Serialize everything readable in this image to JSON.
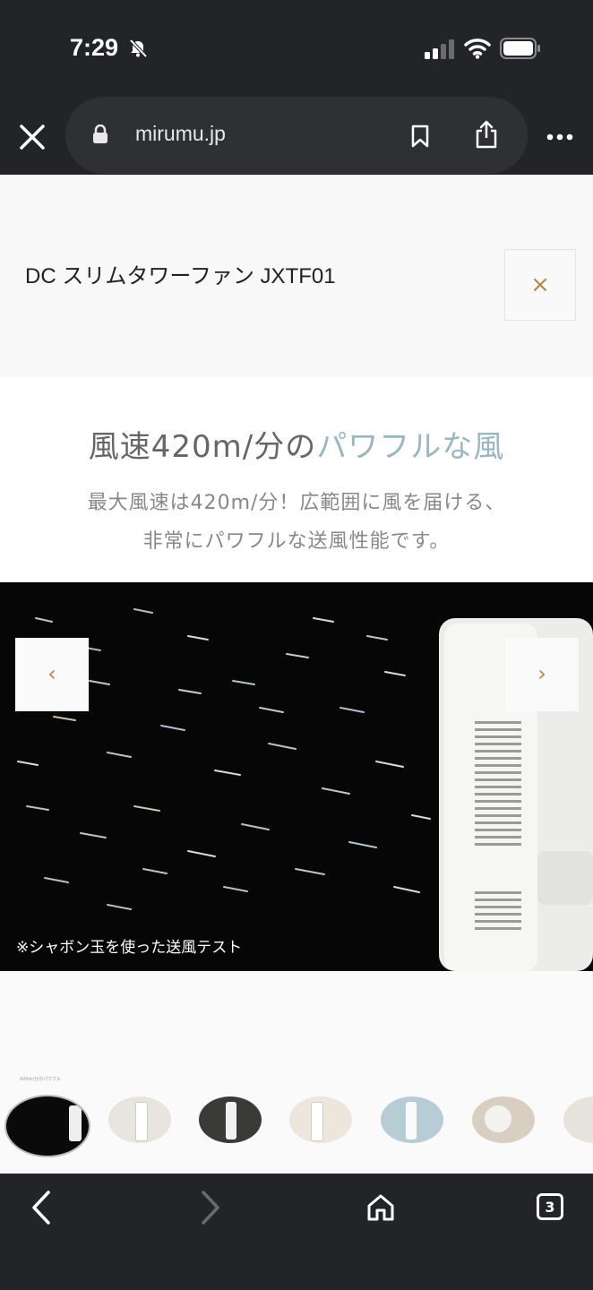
{
  "status_bar": {
    "time": "7:29"
  },
  "browser": {
    "url": "mirumu.jp",
    "tab_count": "3"
  },
  "product": {
    "title": "DC スリムタワーファン JXTF01",
    "close_glyph": "×"
  },
  "feature": {
    "headline_main": "風速420m/分の",
    "headline_accent": "パワフルな風",
    "sub_line1": "最大風速は420m/分！広範囲に風を届ける、",
    "sub_line2": "非常にパワフルな送風性能です。",
    "accent_color": "#9ab6c0"
  },
  "carousel": {
    "caption": "※シャボン玉を使った送風テスト",
    "prev_glyph": "‹",
    "next_glyph": "›",
    "thumb_first_caption": "420m/分のパワフル"
  }
}
